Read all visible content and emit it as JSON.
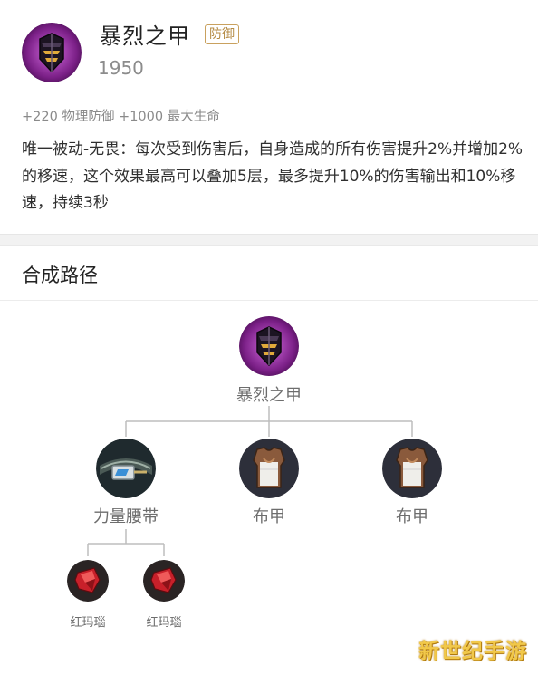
{
  "item": {
    "name": "暴烈之甲",
    "tag": "防御",
    "price": "1950",
    "stats": "+220 物理防御 +1000 最大生命",
    "description": "唯一被动-无畏：每次受到伤害后，自身造成的所有伤害提升2%并增加2%的移速，这个效果最高可以叠加5层，最多提升10%的伤害输出和10%移速，持续3秒",
    "icon": "dark-armor-icon"
  },
  "synthesis": {
    "title": "合成路径",
    "root": {
      "label": "暴烈之甲",
      "icon": "dark-armor-icon"
    },
    "level2": [
      {
        "label": "力量腰带",
        "icon": "belt-icon"
      },
      {
        "label": "布甲",
        "icon": "cloth-armor-icon"
      },
      {
        "label": "布甲",
        "icon": "cloth-armor-icon"
      }
    ],
    "level3": [
      {
        "label": "红玛瑙",
        "icon": "red-gem-icon"
      },
      {
        "label": "红玛瑙",
        "icon": "red-gem-icon"
      }
    ]
  },
  "watermark": "新世纪手游",
  "colors": {
    "tag": "#b48a43",
    "line": "#bdbdbd",
    "watermark": "#f1c84a"
  }
}
